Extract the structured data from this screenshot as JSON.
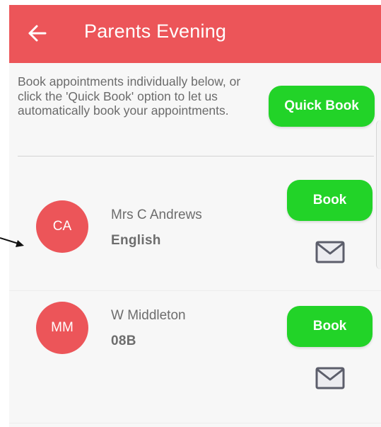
{
  "header": {
    "title": "Parents Evening",
    "back_icon": "arrow-left-icon"
  },
  "intro": {
    "text": "Book appointments individually below, or click the 'Quick Book' option to let us automatically book your appointments.",
    "quick_book_label": "Quick Book"
  },
  "teachers": [
    {
      "initials": "CA",
      "name": "Mrs C Andrews",
      "subject": "English",
      "book_label": "Book",
      "mail_icon": "envelope-icon"
    },
    {
      "initials": "MM",
      "name": "W Middleton",
      "subject": "08B",
      "book_label": "Book",
      "mail_icon": "envelope-icon"
    }
  ],
  "colors": {
    "primary": "#ec5559",
    "accent_green": "#22d328",
    "text_gray": "#6d6d6d"
  }
}
